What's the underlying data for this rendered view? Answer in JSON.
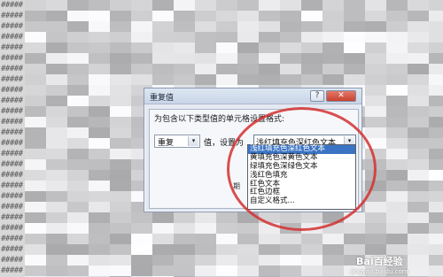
{
  "sheet": {
    "row_hash_text": "#####",
    "visible_cell_text": "期"
  },
  "dialog": {
    "title": "重复值",
    "help_glyph": "?",
    "close_glyph": "✕",
    "instruction": "为包含以下类型值的单元格设置格式:",
    "condition_value": "重复",
    "value_label": "值，设置为",
    "format_value": "浅红填充色深红色文本",
    "dropdown_arrow_glyph": "▾"
  },
  "dropdown": {
    "options": [
      "浅红填充色深红色文本",
      "黄填充色深黄色文本",
      "绿填充色深绿色文本",
      "浅红色填充",
      "红色文本",
      "红色边框",
      "自定义格式..."
    ],
    "selected_index": 0
  },
  "watermark": {
    "brand": "Bai百经验",
    "site": "jingyan.baidu.com"
  },
  "colors": {
    "annotation": "#d43030",
    "selection": "#3b74c4",
    "dialog_bg": "#e4e9f2"
  }
}
